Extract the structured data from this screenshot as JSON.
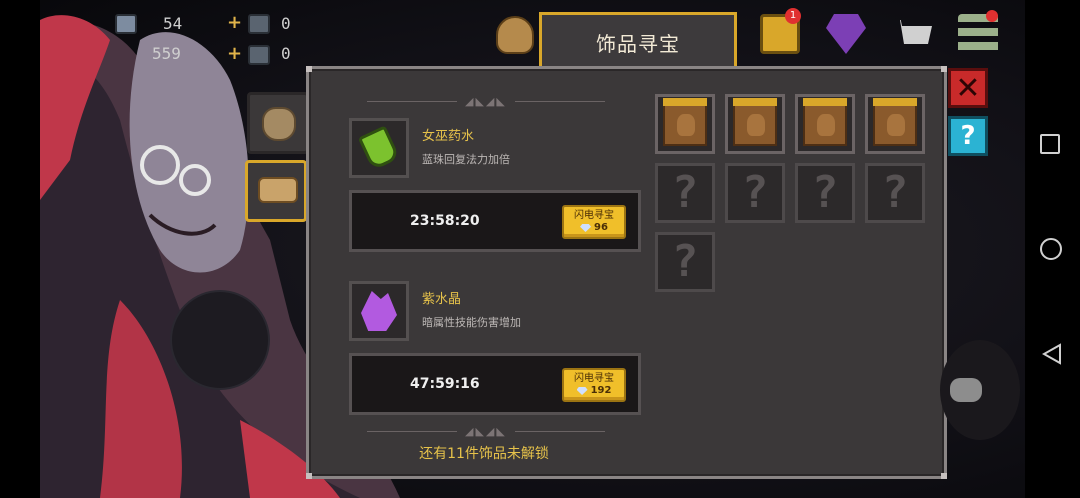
{
  "hud": {
    "gems_partial": "54",
    "gold_partial": "559",
    "material_a_count": "0",
    "material_b_count": "0",
    "plus_sign": "+"
  },
  "tab": {
    "label": "饰品寻宝"
  },
  "items": [
    {
      "name": "女巫药水",
      "desc": "蓝珠回复法力加倍",
      "timer": "23:58:20",
      "button_label": "闪电寻宝",
      "cost": "96"
    },
    {
      "name": "紫水晶",
      "desc": "暗属性技能伤害增加",
      "timer": "47:59:16",
      "button_label": "闪电寻宝",
      "cost": "192"
    }
  ],
  "footer": {
    "text": "还有11件饰品未解锁"
  },
  "slots": {
    "filled_count": 4,
    "locked_count": 5,
    "locked_symbol": "?"
  },
  "side": {
    "close_symbol": "✕",
    "help_symbol": "?"
  },
  "badges": {
    "chest_badge": "1"
  },
  "colors": {
    "accent_gold": "#d9a72a",
    "panel_bg": "#3b3839",
    "item_name": "#e6c24a",
    "button": "#f0bf2a",
    "close": "#c92a2a",
    "help": "#2bb3d3"
  },
  "icons": {
    "potion": "green-potion-icon",
    "crystal": "purple-crystal-icon",
    "gem": "diamond-gem-icon",
    "chest": "treasure-chest-icon",
    "shop": "shopping-cart-icon",
    "menu": "menu-icon"
  }
}
